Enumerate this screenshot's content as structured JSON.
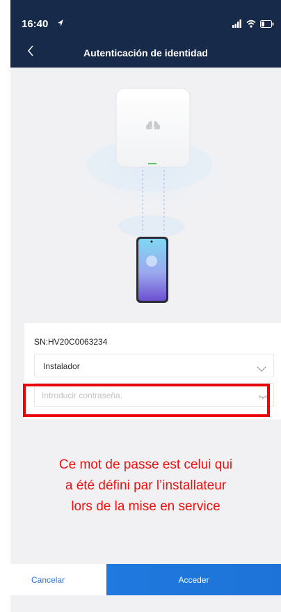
{
  "status_bar": {
    "time": "16:40"
  },
  "header": {
    "title": "Autenticación de identidad"
  },
  "device": {
    "serial": "SN:HV20C0063234"
  },
  "form": {
    "role_value": "Instalador",
    "password_placeholder": "Introducir contraseña."
  },
  "annotation": {
    "line1": "Ce mot de passe est celui qui",
    "line2": "a été défini par l’installateur",
    "line3": "lors de la mise en service"
  },
  "buttons": {
    "cancel": "Cancelar",
    "access": "Acceder"
  },
  "colors": {
    "header_bg": "#172a49",
    "accent_blue": "#1f79de",
    "highlight_red": "#e8060a",
    "note_red": "#ee1111"
  },
  "icons": [
    "location-arrow-icon",
    "signal-icon",
    "wifi-icon",
    "battery-icon",
    "back-arrow-icon",
    "chevron-down-icon",
    "eye-closed-icon",
    "huawei-logo-icon"
  ]
}
